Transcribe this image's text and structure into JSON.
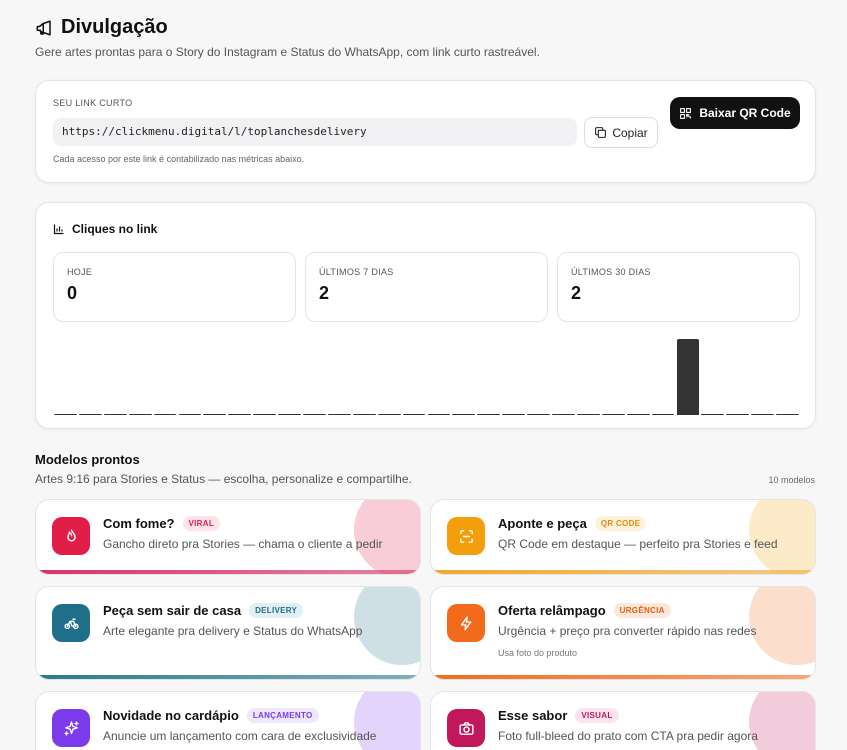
{
  "page": {
    "title": "Divulgação",
    "subtitle": "Gere artes prontas para o Story do Instagram e Status do WhatsApp, com link curto rastreável."
  },
  "link": {
    "label": "SEU LINK CURTO",
    "url": "https://clickmenu.digital/l/toplanchesdelivery",
    "copy_label": "Copiar",
    "qr_label": "Baixar QR Code",
    "hint": "Cada acesso por este link é contabilizado nas métricas abaixo."
  },
  "clicks": {
    "title": "Cliques no link",
    "stats": [
      {
        "label": "HOJE",
        "value": "0"
      },
      {
        "label": "ÚLTIMOS 7 DIAS",
        "value": "2"
      },
      {
        "label": "ÚLTIMOS 30 DIAS",
        "value": "2"
      }
    ],
    "chart_data": {
      "type": "bar",
      "values": [
        0,
        0,
        0,
        0,
        0,
        0,
        0,
        0,
        0,
        0,
        0,
        0,
        0,
        0,
        0,
        0,
        0,
        0,
        0,
        0,
        0,
        0,
        0,
        0,
        0,
        2,
        0,
        0,
        0,
        0
      ],
      "ylim": [
        0,
        2
      ],
      "color": "#333333"
    }
  },
  "templates_section": {
    "title": "Modelos prontos",
    "subtitle": "Artes 9:16 para Stories e Status — escolha, personalize e compartilhe.",
    "count": "10 modelos"
  },
  "templates": [
    {
      "name": "Com fome?",
      "badge": "VIRAL",
      "desc": "Gancho direto pra Stories — chama o cliente a pedir",
      "hint": "",
      "icon": "flame-icon",
      "color": "#e11d48",
      "stripe": "#d6336c",
      "badge_bg": "#fde4ea",
      "badge_fg": "#e11d48"
    },
    {
      "name": "Aponte e peça",
      "badge": "QR CODE",
      "desc": "QR Code em destaque — perfeito pra Stories e feed",
      "hint": "",
      "icon": "scan-icon",
      "color": "#f59e0b",
      "stripe": "#f0a830",
      "badge_bg": "#fef2dc",
      "badge_fg": "#e08a0b"
    },
    {
      "name": "Peça sem sair de casa",
      "badge": "DELIVERY",
      "desc": "Arte elegante pra delivery e Status do WhatsApp",
      "hint": "",
      "icon": "bike-icon",
      "color": "#1f6f8b",
      "stripe": "#2a7a8c",
      "badge_bg": "#e0f0f3",
      "badge_fg": "#1f6f8b"
    },
    {
      "name": "Oferta relâmpago",
      "badge": "URGÊNCIA",
      "desc": "Urgência + preço pra converter rápido nas redes",
      "hint": "Usa foto do produto",
      "icon": "bolt-icon",
      "color": "#f26b1d",
      "stripe": "#f26b1d",
      "badge_bg": "#fde8db",
      "badge_fg": "#e85d10"
    },
    {
      "name": "Novidade no cardápio",
      "badge": "LANÇAMENTO",
      "desc": "Anuncie um lançamento com cara de exclusividade",
      "hint": "",
      "icon": "sparkles-icon",
      "color": "#7c3aed",
      "stripe": "#7c3aed",
      "badge_bg": "#efe7fd",
      "badge_fg": "#7c3aed"
    },
    {
      "name": "Esse sabor",
      "badge": "VISUAL",
      "desc": "Foto full-bleed do prato com CTA pra pedir agora",
      "hint": "",
      "icon": "camera-icon",
      "color": "#c2185b",
      "stripe": "#c2185b",
      "badge_bg": "#fce4ee",
      "badge_fg": "#c2185b"
    }
  ]
}
